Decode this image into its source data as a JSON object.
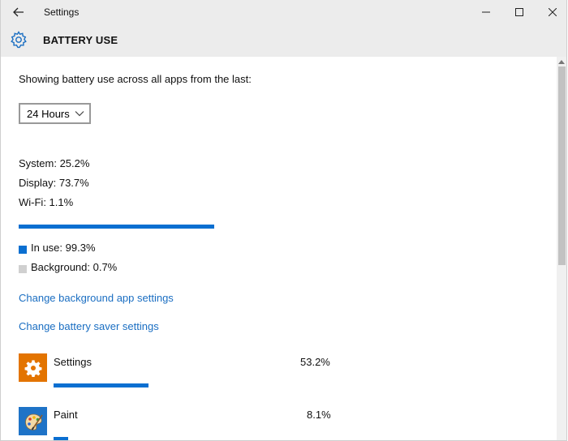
{
  "window": {
    "title": "Settings"
  },
  "header": {
    "title": "BATTERY USE"
  },
  "content": {
    "intro": "Showing battery use across all apps from the last:",
    "dropdown": {
      "selected": "24 Hours"
    },
    "stats": [
      "System: 25.2%",
      "Display: 73.7%",
      "Wi-Fi: 1.1%"
    ],
    "usage_bar": {
      "in_use_fraction": 0.993
    },
    "legend": [
      {
        "label": "In use: 99.3%",
        "color": "#0a6fd1"
      },
      {
        "label": "Background: 0.7%",
        "color": "#d0d0d0"
      }
    ],
    "links": [
      "Change background app settings",
      "Change battery saver settings"
    ],
    "apps": [
      {
        "name": "Settings",
        "percent": "53.2%",
        "icon": "gear-icon",
        "icon_bg": "#e37400",
        "fraction": 0.532
      },
      {
        "name": "Paint",
        "percent": "8.1%",
        "icon": "paint-icon",
        "icon_bg": "#1e73c7",
        "fraction": 0.081
      }
    ]
  },
  "colors": {
    "accent": "#0a6fd1",
    "link": "#1a6ec2",
    "chrome": "#ececec"
  }
}
